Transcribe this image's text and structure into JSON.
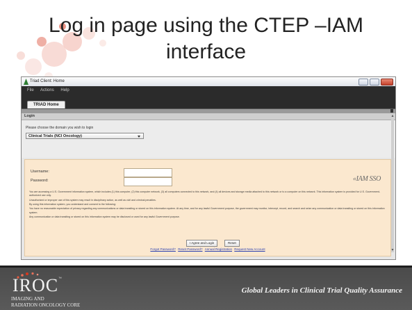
{
  "slide": {
    "title_line1": "Log in page using the CTEP –IAM",
    "title_line2": "interface"
  },
  "window": {
    "title": "Triad Client: Home",
    "menu": [
      "File",
      "Actions",
      "Help"
    ],
    "tab": "TRIAD Home"
  },
  "login": {
    "header": "Login",
    "domain_label": "Please choose the domain you wish to login",
    "domain_selected": "Clinical Trials (NCI Oncology)",
    "username_label": "Username:",
    "password_label": "Password:",
    "username_value": "",
    "password_value": "",
    "iam_logo": "«IAM SSO",
    "legal": [
      "You are accessing a U.S. Government information system, which includes (1) this computer, (2) this computer network, (3) all computers connected to this network, and (4) all devices and storage media attached to this network or to a computer on this network. This information system is provided for U.S. Government-authorized use only.",
      "Unauthorized or improper use of this system may result in disciplinary action, as well as civil and criminal penalties.",
      "By using this information system, you understand and consent to the following:",
      "You have no reasonable expectation of privacy regarding any communications or data transiting or stored on this information system. At any time, and for any lawful Government purpose, the government may monitor, intercept, record, and search and seize any communication or data transiting or stored on this information system.",
      "Any communication or data transiting or stored on this information system may be disclosed or used for any lawful Government purpose."
    ],
    "agree_button": "I Agree and Login",
    "reset_button": "Reset",
    "links": [
      "Forgot Password?",
      "Reset Password?",
      "Annual Registration",
      "Request New Account"
    ]
  },
  "footer": {
    "logo": "IROC",
    "logo_sub1": "IMAGING AND",
    "logo_sub2": "RADIATION ONCOLOGY CORE",
    "tagline": "Global Leaders in Clinical Trial Quality Assurance"
  },
  "colors": {
    "accent": "#d9381e",
    "form_bg": "#fbe8cf",
    "footer_bg": "#4a4a4a",
    "link": "#2a3fb0"
  }
}
